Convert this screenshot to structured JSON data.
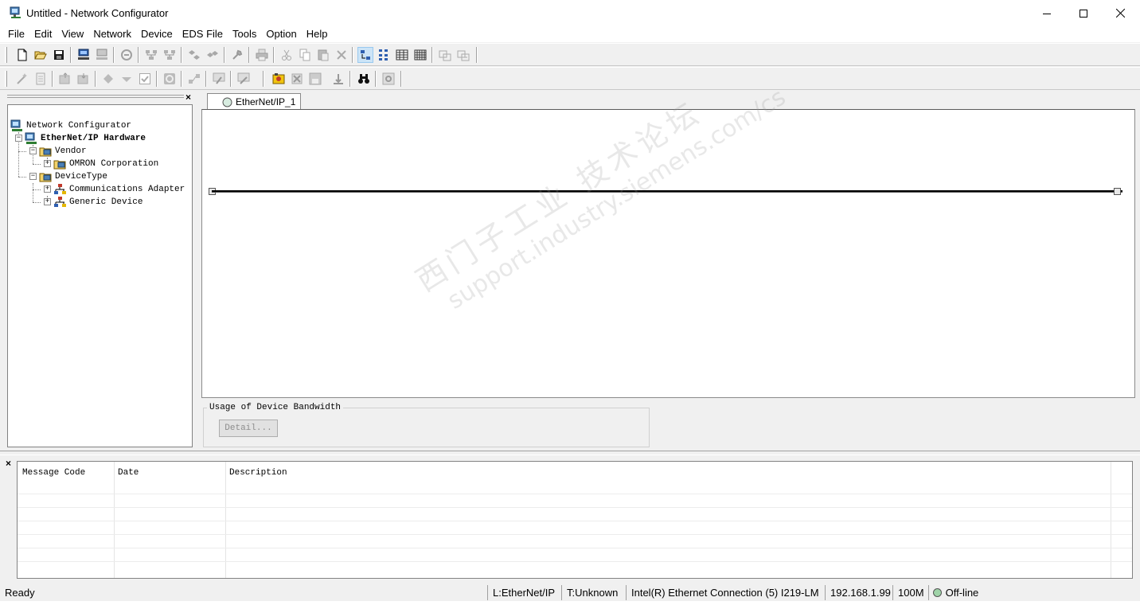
{
  "window": {
    "title": "Untitled - Network Configurator",
    "icon": "network-configurator-icon"
  },
  "menu": [
    "File",
    "Edit",
    "View",
    "Network",
    "Device",
    "EDS File",
    "Tools",
    "Option",
    "Help"
  ],
  "tree": {
    "root": "Network Configurator",
    "hardware": "EtherNet/IP Hardware",
    "vendor": "Vendor",
    "omron": "OMRON Corporation",
    "device_type": "DeviceType",
    "comm_adapter": "Communications Adapter",
    "generic_device": "Generic Device"
  },
  "network_tab": {
    "label": "EtherNet/IP_1"
  },
  "watermark": {
    "line1": "西门子工业 技术论坛",
    "line2": "support.industry.siemens.com/cs"
  },
  "bandwidth": {
    "legend": "Usage of Device Bandwidth",
    "detail_button": "Detail..."
  },
  "messages": {
    "columns": [
      "Message Code",
      "Date",
      "Description"
    ]
  },
  "status": {
    "ready": "Ready",
    "link": "L:EtherNet/IP",
    "target": "T:Unknown",
    "adapter": "Intel(R) Ethernet Connection (5) I219-LM",
    "ip": "192.168.1.99",
    "speed": "100M",
    "state": "Off-line"
  },
  "colors": {
    "canvas": "#ffffff",
    "chrome": "#f0f0f0",
    "pressed": "#cce4f7",
    "offline_dot": "#9fd3a8"
  }
}
